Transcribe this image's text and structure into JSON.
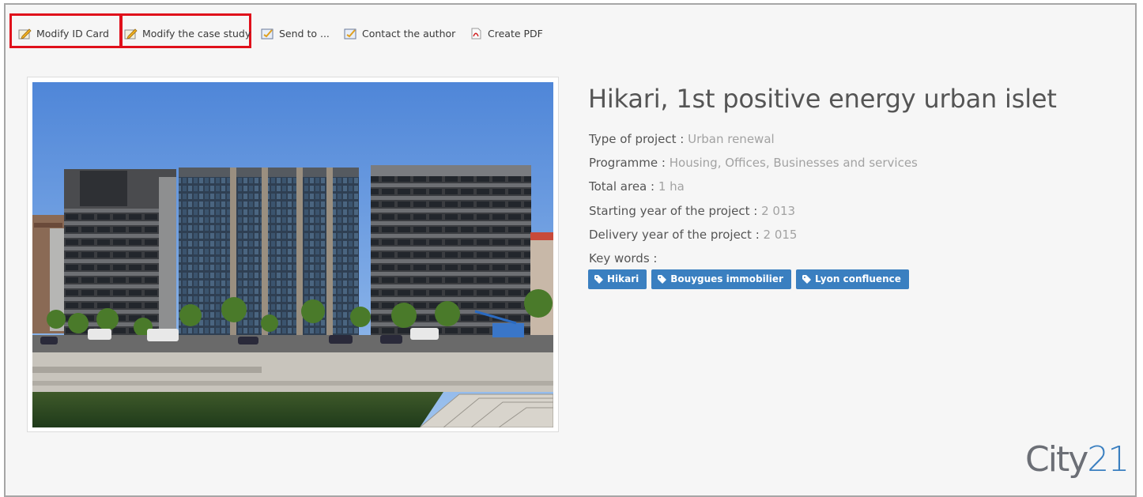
{
  "toolbar": {
    "modify_id_card": "Modify ID Card",
    "modify_case_study": "Modify the case study",
    "send_to": "Send to ...",
    "contact_author": "Contact the author",
    "create_pdf": "Create PDF"
  },
  "project": {
    "title": "Hikari, 1st positive energy urban islet",
    "fields": [
      {
        "label": "Type of project",
        "value": "Urban renewal"
      },
      {
        "label": "Programme",
        "value": "Housing, Offices, Businesses and services"
      },
      {
        "label": "Total area",
        "value": "1 ha"
      },
      {
        "label": "Starting year of the project",
        "value": "2 013"
      },
      {
        "label": "Delivery year of the project",
        "value": "2 015"
      }
    ],
    "keywords_label": "Key words :",
    "keywords": [
      "Hikari",
      "Bouygues immobilier",
      "Lyon confluence"
    ]
  },
  "logo": {
    "text_a": "City",
    "text_b": "21"
  },
  "colors": {
    "accent": "#3a7fc0",
    "highlight": "#e0101b",
    "label": "#555555",
    "value": "#a2a2a2"
  }
}
